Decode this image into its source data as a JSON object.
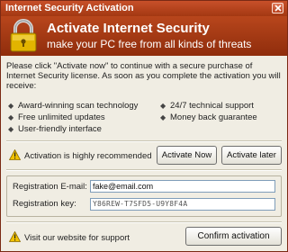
{
  "window": {
    "title": "Internet Security Activation"
  },
  "banner": {
    "title": "Activate Internet Security",
    "subtitle": "make your PC free from all kinds of threats"
  },
  "intro_text": "Please click \"Activate now\" to continue with a secure purchase of Internet Security license. As soon as you complete the activation you will receive:",
  "features": [
    "Award-winning scan technology",
    "24/7 technical support",
    "Free unlimited updates",
    "Money back guarantee",
    "User-friendly interface"
  ],
  "status": {
    "text": "Activation is highly recommended",
    "activate_now_label": "Activate Now",
    "activate_later_label": "Activate later"
  },
  "registration": {
    "email_label": "Registration E-mail:",
    "email_value": "fake@email.com",
    "key_label": "Registration key:",
    "key_value": "Y86REW-T7SFD5-U9Y8F4A"
  },
  "footer": {
    "support_text": "Visit our website for support",
    "confirm_label": "Confirm activation"
  },
  "colors": {
    "title_bar": "#b8461c",
    "banner": "#a33812",
    "content_bg": "#f0ede3",
    "warning": "#f2c200"
  },
  "icons": [
    "close-icon",
    "padlock-icon",
    "warning-icon"
  ]
}
